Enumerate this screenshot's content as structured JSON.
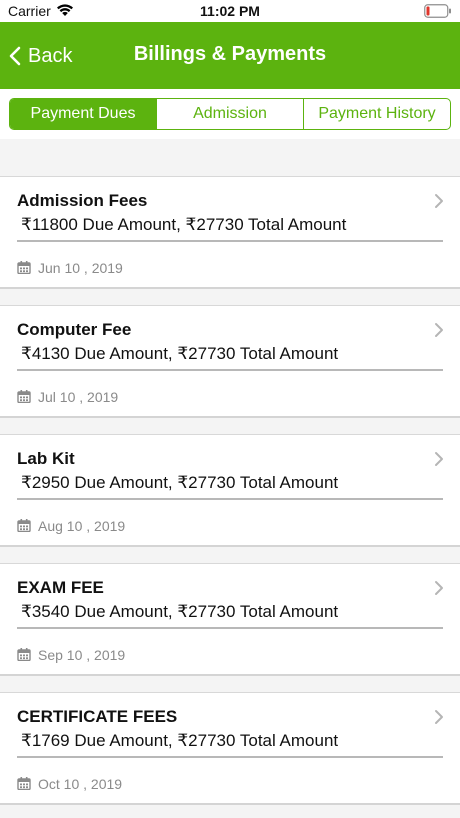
{
  "status": {
    "carrier": "Carrier",
    "time": "11:02 PM"
  },
  "nav": {
    "back_label": "Back",
    "title": "Billings & Payments"
  },
  "tabs": [
    {
      "label": "Payment Dues",
      "active": true
    },
    {
      "label": "Admission",
      "active": false
    },
    {
      "label": "Payment History",
      "active": false
    }
  ],
  "dues": [
    {
      "name": "Admission Fees",
      "amounts": "₹11800 Due Amount, ₹27730 Total Amount",
      "date": "Jun 10 , 2019"
    },
    {
      "name": "Computer Fee",
      "amounts": "₹4130 Due Amount, ₹27730 Total Amount",
      "date": "Jul 10 , 2019"
    },
    {
      "name": "Lab Kit",
      "amounts": "₹2950 Due Amount, ₹27730 Total Amount",
      "date": "Aug 10 , 2019"
    },
    {
      "name": "EXAM FEE",
      "amounts": "₹3540 Due Amount, ₹27730 Total Amount",
      "date": "Sep 10 , 2019"
    },
    {
      "name": "CERTIFICATE FEES",
      "amounts": "₹1769 Due Amount, ₹27730 Total Amount",
      "date": "Oct 10 , 2019"
    }
  ],
  "colors": {
    "accent": "#5cb30f",
    "battery_low": "#e0352b"
  },
  "icons": [
    "wifi-icon",
    "battery-icon",
    "back-chevron-icon",
    "chevron-right-icon",
    "calendar-icon"
  ]
}
